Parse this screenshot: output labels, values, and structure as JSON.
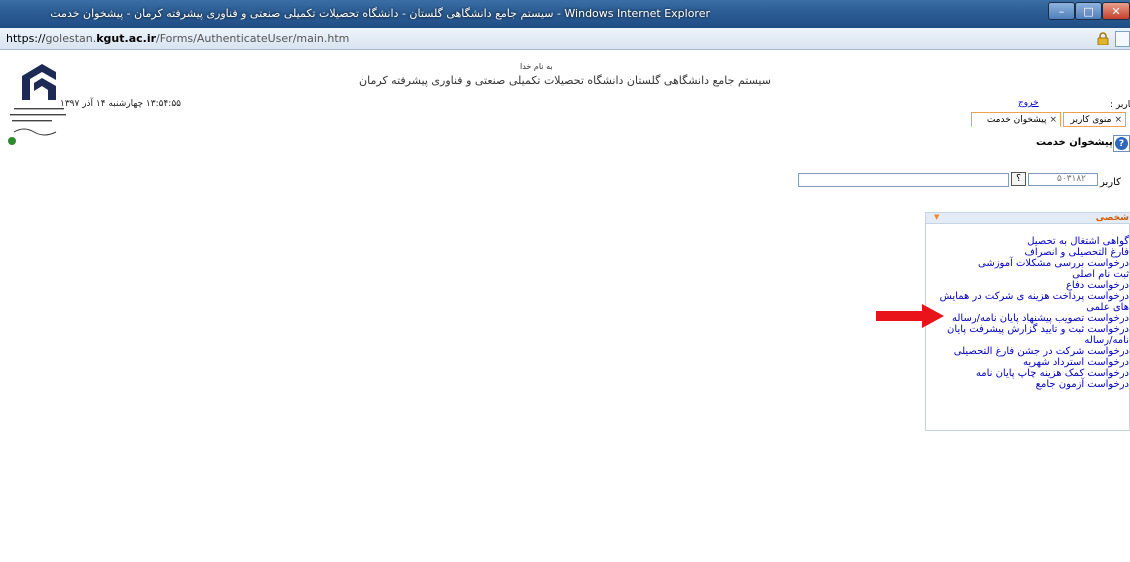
{
  "window": {
    "title": "سیستم جامع دانشگاهی گلستان - دانشگاه تحصیلات تکمیلی صنعتی و فناوری پیشرفته کرمان - پیشخوان خدمت - Windows Internet Explorer",
    "minimize_label": "–",
    "maximize_label": "□",
    "close_label": "✕"
  },
  "address_bar": {
    "protocol": "https://",
    "host_prefix": "golestan.",
    "host_main": "kgut.ac.ir",
    "path": "/Forms/AuthenticateUser/main.htm"
  },
  "header": {
    "bismillah": "به نام خدا",
    "system_title": "سیستم جامع دانشگاهی گلستان   دانشگاه تحصیلات تکمیلی صنعتی و فناوری پیشرفته کرمان",
    "datetime": "۱۳:۵۴:۵۵ چهارشنبه ۱۴ آذر ۱۳۹۷",
    "user_label": "کاربر :",
    "logout": "خروج"
  },
  "tabs": [
    {
      "label": "منوی کاربر",
      "close": "×"
    },
    {
      "label": "پیشخوان خدمت",
      "close": "×"
    }
  ],
  "page": {
    "title": "پیشخوان خدمت",
    "help_icon": "?",
    "caller_label": "کاربر",
    "code_value": "۵۰۳۱۸۲",
    "lookup_label": "؟"
  },
  "panel": {
    "title": "شخصی",
    "arrow": "▼",
    "items": [
      "گواهی اشتغال به تحصیل",
      "فارغ التحصیلی و انصراف",
      "درخواست بررسی مشکلات آموزشی",
      "ثبت نام اصلی",
      "درخواست دفاع",
      "درخواست پرداخت هزینه ی شرکت در همایش",
      "های علمی",
      "درخواست تصویب پیشنهاد پایان نامه/رساله",
      "درخواست ثبت و تایید گزارش پیشرفت پایان",
      "نامه/رساله",
      "درخواست شرکت در جشن فارغ التحصیلی",
      "درخواست استرداد شهریه",
      "درخواست کمک هزینه چاپ پایان نامه",
      "درخواست آزمون جامع"
    ]
  },
  "colors": {
    "titlebar": "#2b5c93",
    "link": "#0000c8",
    "tab_border": "#f0a050",
    "panel_title": "#d05a00",
    "annotation_arrow": "#e8141a"
  }
}
